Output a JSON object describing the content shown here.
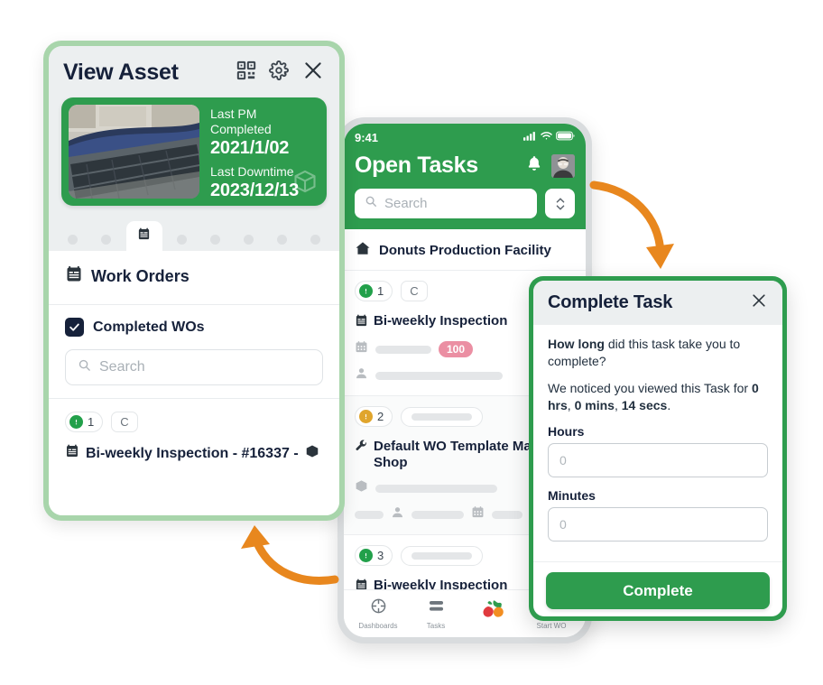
{
  "view_asset": {
    "title": "View Asset",
    "header_icons": [
      "qr-code-icon",
      "gear-icon",
      "close-icon"
    ],
    "asset_card": {
      "last_pm_label": "Last PM Completed",
      "last_pm_value": "2021/1/02",
      "last_downtime_label": "Last Downtime",
      "last_downtime_value": "2023/12/13",
      "photo_alt": "conveyor-rollers-photo",
      "bg_color": "#2e9c4e"
    },
    "tabs": {
      "count": 8,
      "active_index": 2,
      "active_icon": "clipboard-icon"
    },
    "work_orders": {
      "section_label": "Work Orders",
      "completed_filter_label": "Completed WOs",
      "completed_filter_checked": true,
      "search_placeholder": "Search",
      "items": [
        {
          "priority": "1",
          "priority_color": "#22a04a",
          "code_chip": "C",
          "title": "Bi-weekly Inspection - #16337 -"
        }
      ]
    },
    "border_color": "#a8d5ab"
  },
  "phone": {
    "status_bar": {
      "time": "9:41",
      "icons": [
        "cellular-signal-icon",
        "wifi-icon",
        "battery-icon"
      ]
    },
    "title": "Open Tasks",
    "bell_icon": "bell-icon",
    "avatar": "user-avatar",
    "search_placeholder": "Search",
    "sort_icon": "sort-updown-icon",
    "facility": "Donuts Production Facility",
    "tasks": [
      {
        "priority": "1",
        "priority_color": "#22a04a",
        "code_chip": "C",
        "title": "Bi-weekly Inspection",
        "badge": "100",
        "badge_color": "#eb8fa3",
        "icon": "clipboard-icon"
      },
      {
        "priority": "2",
        "priority_color": "#e0a52c",
        "code_chip": "",
        "title": "Default WO Template Machine Shop",
        "icon": "wrench-icon"
      },
      {
        "priority": "3",
        "priority_color": "#22a04a",
        "code_chip": "",
        "title": "Bi-weekly Inspection",
        "icon": "clipboard-icon"
      }
    ],
    "tab_bar": [
      {
        "label": "Dashboards",
        "icon": "dashboard-icon"
      },
      {
        "label": "Tasks",
        "icon": "tasks-icon"
      },
      {
        "label": "",
        "icon": "app-logo-icon"
      },
      {
        "label": "Start WO",
        "icon": "start-wo-icon"
      }
    ],
    "header_color": "#2e9c4e"
  },
  "modal": {
    "title": "Complete Task",
    "close_icon": "close-icon",
    "question_bold": "How long",
    "question_rest": " did this task take you to complete?",
    "notice_prefix": "We noticed you viewed this Task for ",
    "notice_hrs": "0 hrs",
    "notice_sep1": ", ",
    "notice_mins": "0 mins",
    "notice_sep2": ", ",
    "notice_secs": "14 secs",
    "notice_end": ".",
    "hours_label": "Hours",
    "hours_placeholder": "0",
    "hours_value": "",
    "minutes_label": "Minutes",
    "minutes_placeholder": "0",
    "minutes_value": "",
    "complete_button": "Complete",
    "accent_color": "#2e9c4e"
  },
  "arrows": {
    "top": "curved-arrow-down",
    "bottom": "curved-arrow-up-left",
    "color": "#e8871e"
  }
}
